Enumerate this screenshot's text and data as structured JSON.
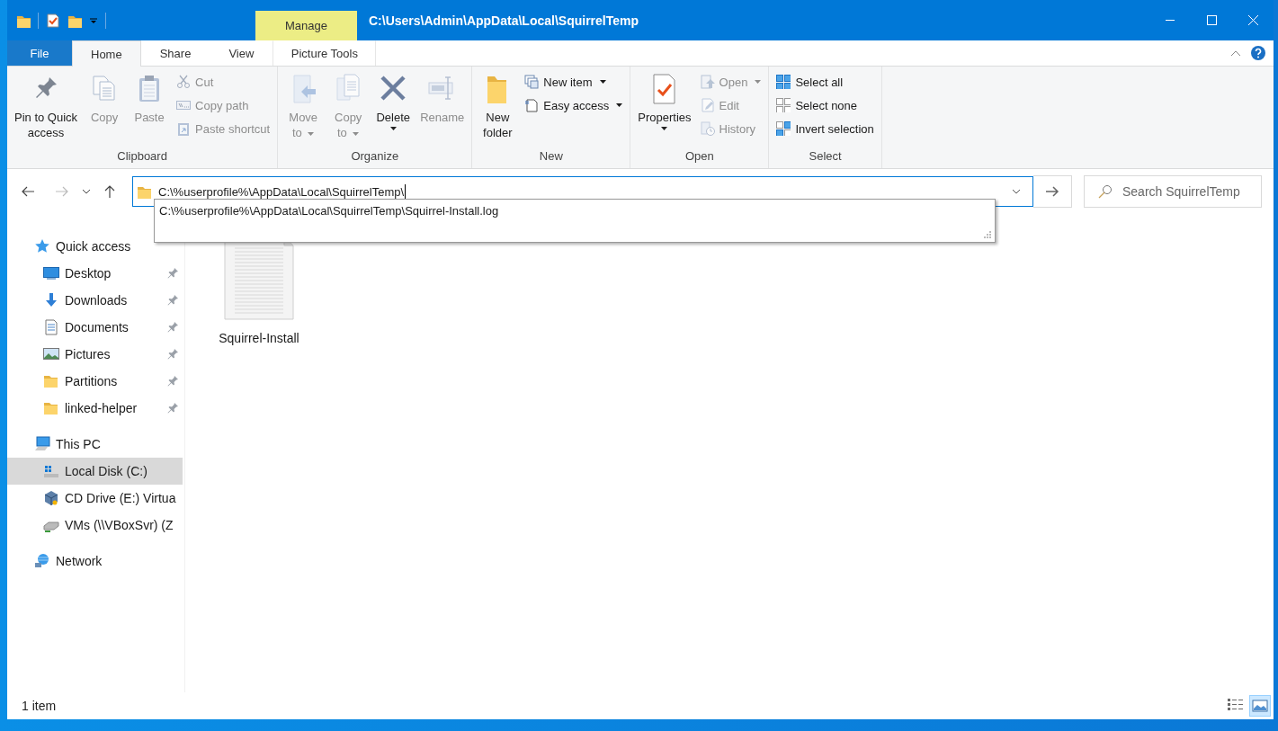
{
  "window": {
    "title": "C:\\Users\\Admin\\AppData\\Local\\SquirrelTemp",
    "context_tab": "Manage"
  },
  "tabs": [
    {
      "label": "File",
      "kind": "file",
      "selected": false
    },
    {
      "label": "Home",
      "kind": "tab",
      "selected": true
    },
    {
      "label": "Share",
      "kind": "tab",
      "selected": false
    },
    {
      "label": "View",
      "kind": "tab",
      "selected": false
    },
    {
      "label": "Picture Tools",
      "kind": "context",
      "selected": false
    }
  ],
  "ribbon": {
    "groups": [
      {
        "label": "Clipboard",
        "buttons": [
          {
            "label": "Pin to Quick\naccess",
            "kind": "large",
            "disabled": false
          },
          {
            "label": "Copy",
            "kind": "large",
            "disabled": true
          },
          {
            "label": "Paste",
            "kind": "large",
            "disabled": true
          },
          {
            "label": "Cut",
            "kind": "small",
            "disabled": true
          },
          {
            "label": "Copy path",
            "kind": "small",
            "disabled": true
          },
          {
            "label": "Paste shortcut",
            "kind": "small",
            "disabled": true
          }
        ]
      },
      {
        "label": "Organize",
        "buttons": [
          {
            "label": "Move\nto",
            "kind": "large",
            "disabled": true,
            "dropdown": true
          },
          {
            "label": "Copy\nto",
            "kind": "large",
            "disabled": true,
            "dropdown": true
          },
          {
            "label": "Delete",
            "kind": "split",
            "disabled": false
          },
          {
            "label": "Rename",
            "kind": "large",
            "disabled": true
          }
        ]
      },
      {
        "label": "New",
        "buttons": [
          {
            "label": "New\nfolder",
            "kind": "large",
            "disabled": false
          },
          {
            "label": "New item",
            "kind": "small",
            "disabled": false,
            "dropdown": true
          },
          {
            "label": "Easy access",
            "kind": "small",
            "disabled": false,
            "dropdown": true
          }
        ]
      },
      {
        "label": "Open",
        "buttons": [
          {
            "label": "Properties",
            "kind": "split",
            "disabled": false
          },
          {
            "label": "Open",
            "kind": "small",
            "disabled": true,
            "dropdown": true
          },
          {
            "label": "Edit",
            "kind": "small",
            "disabled": true
          },
          {
            "label": "History",
            "kind": "small",
            "disabled": true
          }
        ]
      },
      {
        "label": "Select",
        "buttons": [
          {
            "label": "Select all",
            "kind": "small",
            "disabled": false
          },
          {
            "label": "Select none",
            "kind": "small",
            "disabled": false
          },
          {
            "label": "Invert selection",
            "kind": "small",
            "disabled": false
          }
        ]
      }
    ]
  },
  "address_bar": {
    "value": "C:\\%userprofile%\\AppData\\Local\\SquirrelTemp\\",
    "suggestions": [
      "C:\\%userprofile%\\AppData\\Local\\SquirrelTemp\\Squirrel-Install.log"
    ]
  },
  "search": {
    "placeholder": "Search SquirrelTemp"
  },
  "sidebar": {
    "items": [
      {
        "label": "Quick access",
        "kind": "star",
        "selected": false,
        "children": [
          {
            "label": "Desktop",
            "kind": "desktop",
            "pinned": true,
            "selected": false
          },
          {
            "label": "Downloads",
            "kind": "download",
            "pinned": true,
            "selected": false
          },
          {
            "label": "Documents",
            "kind": "documents",
            "pinned": true,
            "selected": false
          },
          {
            "label": "Pictures",
            "kind": "pictures",
            "pinned": true,
            "selected": false
          },
          {
            "label": "Partitions",
            "kind": "folder",
            "pinned": true,
            "selected": false
          },
          {
            "label": "linked-helper",
            "kind": "folder",
            "pinned": true,
            "selected": false
          }
        ]
      },
      {
        "label": "This PC",
        "kind": "pc",
        "selected": false,
        "children": [
          {
            "label": "Local Disk (C:)",
            "kind": "disk",
            "pinned": false,
            "selected": true
          },
          {
            "label": "CD Drive (E:) Virtua",
            "kind": "cd",
            "pinned": false,
            "selected": false
          },
          {
            "label": "VMs (\\\\VBoxSvr) (Z",
            "kind": "netdrive",
            "pinned": false,
            "selected": false
          }
        ]
      },
      {
        "label": "Network",
        "kind": "network",
        "selected": false
      }
    ]
  },
  "files": [
    {
      "name": "Squirrel-Install",
      "kind": "text",
      "selected": false
    }
  ],
  "status_bar": {
    "text": "1 item",
    "views": [
      {
        "kind": "details",
        "selected": false
      },
      {
        "kind": "large",
        "selected": true
      }
    ]
  }
}
